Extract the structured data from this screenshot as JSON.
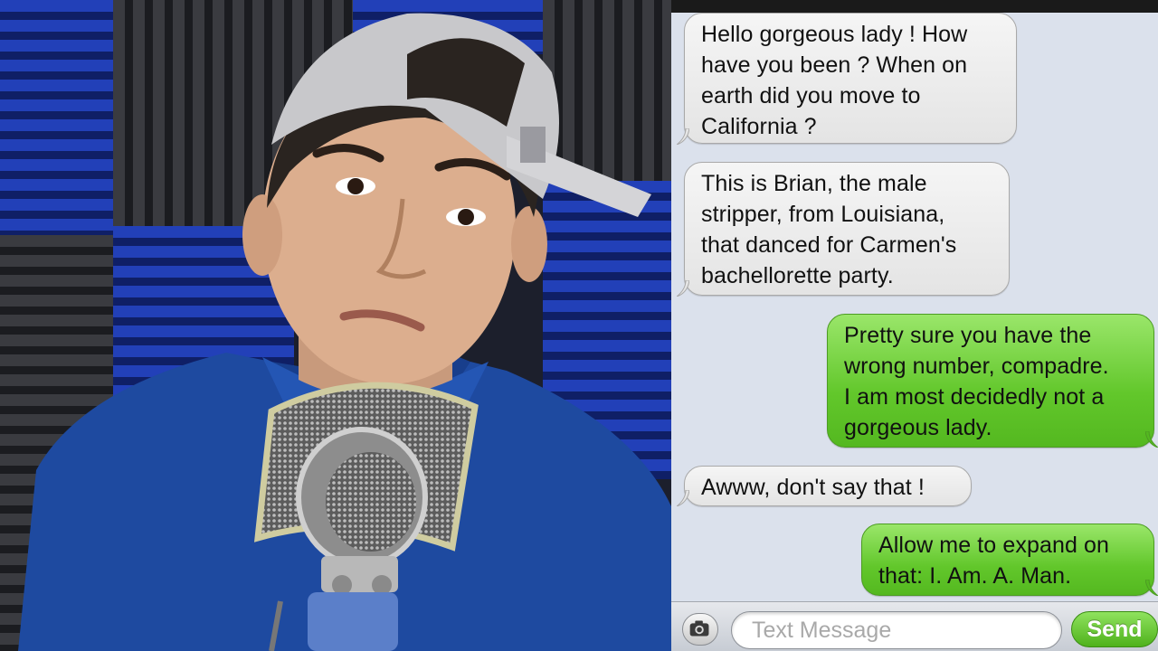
{
  "messages": [
    {
      "direction": "incoming",
      "lines": [
        "Hello gorgeous lady !  How",
        "have you been ?  When on",
        "earth did you move to",
        "California ?"
      ]
    },
    {
      "direction": "incoming",
      "lines": [
        "This is Brian, the male",
        "stripper, from Louisiana,",
        "that danced for Carmen's",
        "bachellorette party."
      ]
    },
    {
      "direction": "outgoing",
      "lines": [
        "Pretty sure you have the",
        "wrong number, compadre.",
        "I am most decidedly not a",
        "gorgeous lady."
      ]
    },
    {
      "direction": "incoming",
      "lines": [
        "Awww, don't say that !"
      ]
    },
    {
      "direction": "outgoing",
      "lines": [
        "Allow me to expand on",
        "that: I. Am. A. Man."
      ]
    }
  ],
  "composer": {
    "placeholder": "Text Message",
    "send_label": "Send",
    "camera_icon": "camera-icon"
  },
  "colors": {
    "incoming_bubble": "#ececec",
    "outgoing_bubble": "#62c72b",
    "panel_background": "#dbe1ec"
  }
}
